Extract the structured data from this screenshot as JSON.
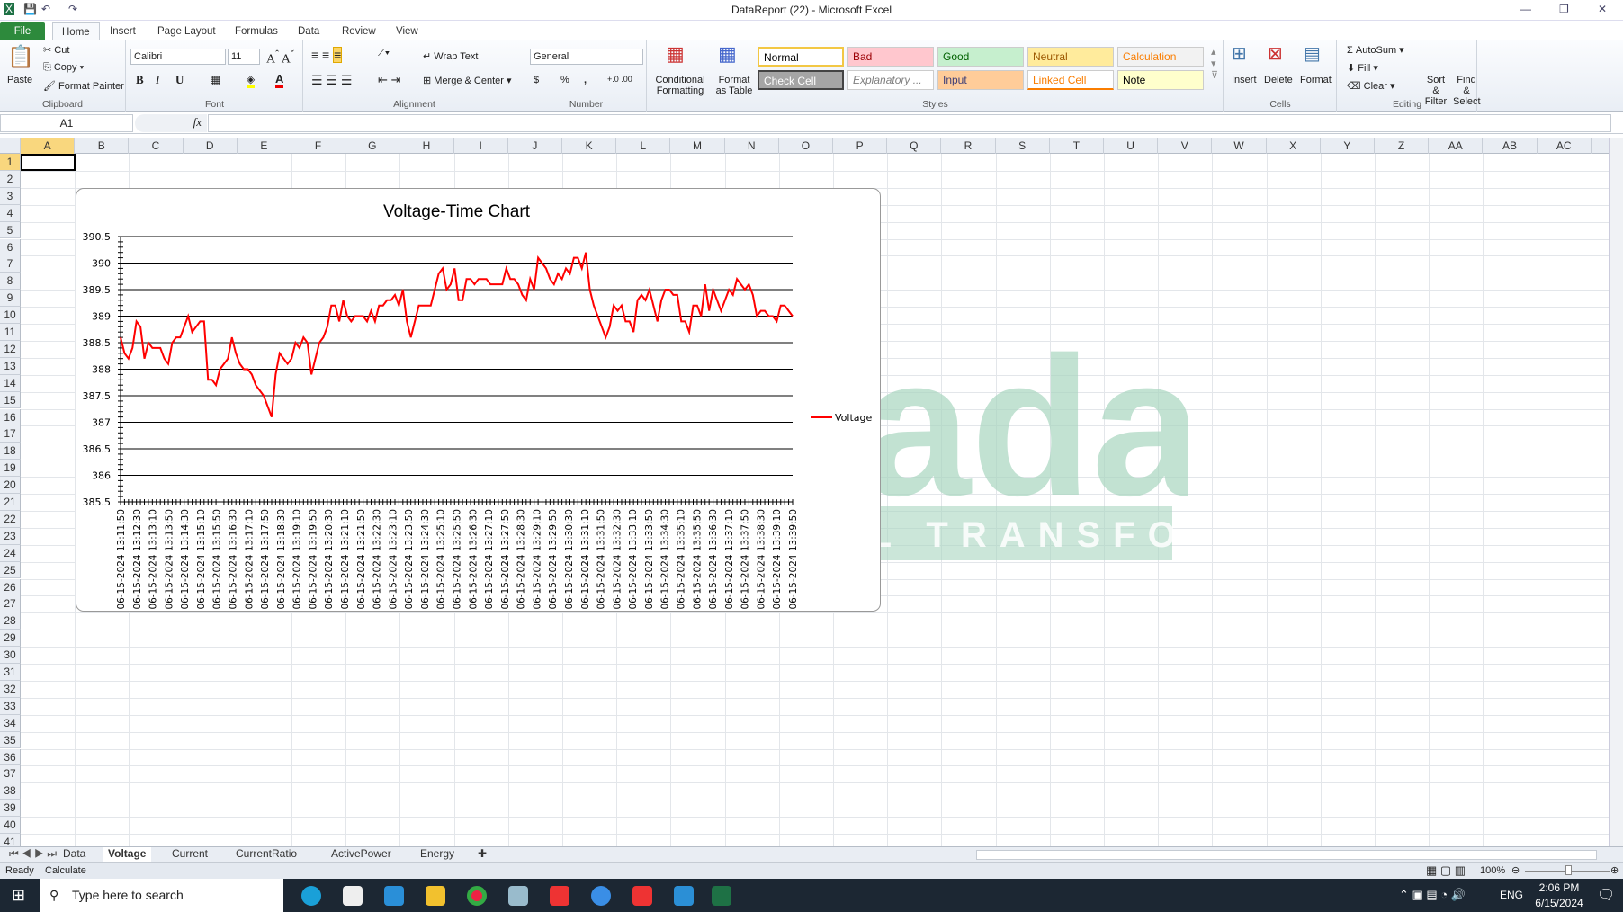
{
  "window": {
    "title": "DataReport (22)  -  Microsoft Excel"
  },
  "ribbon_tabs": [
    "File",
    "Home",
    "Insert",
    "Page Layout",
    "Formulas",
    "Data",
    "Review",
    "View"
  ],
  "clipboard": {
    "paste": "Paste",
    "cut": "Cut",
    "copy": "Copy",
    "format_painter": "Format Painter",
    "label": "Clipboard"
  },
  "font": {
    "name": "Calibri",
    "size": "11",
    "bold": "B",
    "italic": "I",
    "underline": "U",
    "label": "Font"
  },
  "alignment": {
    "wrap": "Wrap Text",
    "merge": "Merge & Center",
    "label": "Alignment"
  },
  "number": {
    "format": "General",
    "currency": "$",
    "percent": "%",
    "comma": ",",
    "label": "Number"
  },
  "styles": {
    "cond": "Conditional Formatting",
    "table": "Format as Table",
    "label": "Styles",
    "cells": [
      {
        "name": "Normal",
        "bg": "#ffffff",
        "fg": "#000000"
      },
      {
        "name": "Bad",
        "bg": "#ffc7ce",
        "fg": "#9c0006"
      },
      {
        "name": "Good",
        "bg": "#c6efce",
        "fg": "#006100"
      },
      {
        "name": "Neutral",
        "bg": "#ffeb9c",
        "fg": "#9c5700"
      },
      {
        "name": "Calculation",
        "bg": "#f2f2f2",
        "fg": "#fa7d00"
      },
      {
        "name": "Check Cell",
        "bg": "#a5a5a5",
        "fg": "#ffffff"
      },
      {
        "name": "Explanatory ...",
        "bg": "#ffffff",
        "fg": "#7f7f7f"
      },
      {
        "name": "Input",
        "bg": "#ffcc99",
        "fg": "#3f3f76"
      },
      {
        "name": "Linked Cell",
        "bg": "#ffffff",
        "fg": "#fa7d00"
      },
      {
        "name": "Note",
        "bg": "#ffffcc",
        "fg": "#000000"
      }
    ]
  },
  "cells_group": {
    "insert": "Insert",
    "delete": "Delete",
    "format": "Format",
    "label": "Cells"
  },
  "editing": {
    "autosum": "AutoSum",
    "fill": "Fill",
    "clear": "Clear",
    "sort": "Sort & Filter",
    "find": "Find & Select",
    "label": "Editing"
  },
  "formula_bar": {
    "name_box": "A1",
    "fx": "fx",
    "value": ""
  },
  "columns": [
    "A",
    "B",
    "C",
    "D",
    "E",
    "F",
    "G",
    "H",
    "I",
    "J",
    "K",
    "L",
    "M",
    "N",
    "O",
    "P",
    "Q",
    "R",
    "S",
    "T",
    "U",
    "V",
    "W",
    "X",
    "Y",
    "Z",
    "AA",
    "AB",
    "AC"
  ],
  "rows": [
    "1",
    "2",
    "3",
    "4",
    "5",
    "6",
    "7",
    "8",
    "9",
    "10",
    "11",
    "12",
    "13",
    "14",
    "15",
    "16",
    "17",
    "18",
    "19",
    "20",
    "21",
    "22",
    "23",
    "24",
    "25",
    "26",
    "27",
    "28",
    "29",
    "30",
    "31",
    "32",
    "33",
    "34",
    "35",
    "36",
    "37",
    "38",
    "39",
    "40",
    "41"
  ],
  "chart_data": {
    "type": "line",
    "title": "Voltage-Time Chart",
    "ylim": [
      385.5,
      390.5
    ],
    "yticks": [
      385.5,
      386,
      386.5,
      387,
      387.5,
      388,
      388.5,
      389,
      389.5,
      390,
      390.5
    ],
    "grid": true,
    "legend": "right",
    "line_color": "#ff0000",
    "series": [
      {
        "name": "Voltage",
        "values": [
          388.6,
          388.3,
          388.2,
          388.4,
          388.9,
          388.8,
          388.2,
          388.5,
          388.4,
          388.4,
          388.4,
          388.2,
          388.1,
          388.5,
          388.6,
          388.6,
          388.8,
          389.0,
          388.7,
          388.8,
          388.9,
          388.9,
          387.8,
          387.8,
          387.7,
          388.0,
          388.1,
          388.2,
          388.6,
          388.3,
          388.1,
          388.0,
          388.0,
          387.9,
          387.7,
          387.6,
          387.5,
          387.3,
          387.1,
          387.9,
          388.3,
          388.2,
          388.1,
          388.2,
          388.5,
          388.4,
          388.6,
          388.5,
          387.9,
          388.2,
          388.5,
          388.6,
          388.8,
          389.2,
          389.2,
          388.9,
          389.3,
          389.0,
          388.9,
          389.0,
          389.0,
          389.0,
          388.9,
          389.1,
          388.9,
          389.2,
          389.2,
          389.3,
          389.3,
          389.4,
          389.2,
          389.5,
          388.9,
          388.6,
          388.9,
          389.2,
          389.2,
          389.2,
          389.2,
          389.5,
          389.8,
          389.9,
          389.5,
          389.6,
          389.9,
          389.3,
          389.3,
          389.7,
          389.7,
          389.6,
          389.7,
          389.7,
          389.7,
          389.6,
          389.6,
          389.6,
          389.6,
          389.9,
          389.7,
          389.7,
          389.6,
          389.4,
          389.3,
          389.7,
          389.5,
          390.1,
          390.0,
          389.9,
          389.7,
          389.6,
          389.8,
          389.7,
          389.9,
          389.8,
          390.1,
          390.1,
          389.9,
          390.2,
          389.5,
          389.2,
          389.0,
          388.8,
          388.6,
          388.8,
          389.2,
          389.1,
          389.2,
          388.9,
          388.9,
          388.7,
          389.3,
          389.4,
          389.3,
          389.5,
          389.2,
          388.9,
          389.3,
          389.5,
          389.5,
          389.4,
          389.4,
          388.9,
          388.9,
          388.7,
          389.2,
          389.2,
          389.0,
          389.6,
          389.1,
          389.5,
          389.3,
          389.1,
          389.3,
          389.5,
          389.4,
          389.7,
          389.6,
          389.5,
          389.6,
          389.4,
          389.0,
          389.1,
          389.1,
          389.0,
          389.0,
          388.9,
          389.2,
          389.2,
          389.1,
          389.0
        ]
      }
    ],
    "categories": [
      "06-15-2024 13:11:50",
      "06-15-2024 13:12:30",
      "06-15-2024 13:13:10",
      "06-15-2024 13:13:50",
      "06-15-2024 13:14:30",
      "06-15-2024 13:15:10",
      "06-15-2024 13:15:50",
      "06-15-2024 13:16:30",
      "06-15-2024 13:17:10",
      "06-15-2024 13:17:50",
      "06-15-2024 13:18:30",
      "06-15-2024 13:19:10",
      "06-15-2024 13:19:50",
      "06-15-2024 13:20:30",
      "06-15-2024 13:21:10",
      "06-15-2024 13:21:50",
      "06-15-2024 13:22:30",
      "06-15-2024 13:23:10",
      "06-15-2024 13:23:50",
      "06-15-2024 13:24:30",
      "06-15-2024 13:25:10",
      "06-15-2024 13:25:50",
      "06-15-2024 13:26:30",
      "06-15-2024 13:27:10",
      "06-15-2024 13:27:50",
      "06-15-2024 13:28:30",
      "06-15-2024 13:29:10",
      "06-15-2024 13:29:50",
      "06-15-2024 13:30:30",
      "06-15-2024 13:31:10",
      "06-15-2024 13:31:50",
      "06-15-2024 13:32:30",
      "06-15-2024 13:33:10",
      "06-15-2024 13:33:50",
      "06-15-2024 13:34:30",
      "06-15-2024 13:35:10",
      "06-15-2024 13:35:50",
      "06-15-2024 13:36:30",
      "06-15-2024 13:37:10",
      "06-15-2024 13:37:50",
      "06-15-2024 13:38:30",
      "06-15-2024 13:39:10",
      "06-15-2024 13:39:50"
    ]
  },
  "watermark": {
    "brand": "ATscada",
    "tagline": "DIGITAL TRANSFORMATION",
    "red": "#f4b6b6",
    "green": "#a9d6c0"
  },
  "sheet_tabs": [
    "Data",
    "Voltage",
    "Current",
    "CurrentRatio",
    "ActivePower",
    "Energy"
  ],
  "active_sheet": "Voltage",
  "status": {
    "ready": "Ready",
    "calculate": "Calculate",
    "zoom": "100%"
  },
  "taskbar": {
    "search_placeholder": "Type here to search",
    "time": "2:06 PM",
    "date": "6/15/2024",
    "lang": "ENG"
  }
}
